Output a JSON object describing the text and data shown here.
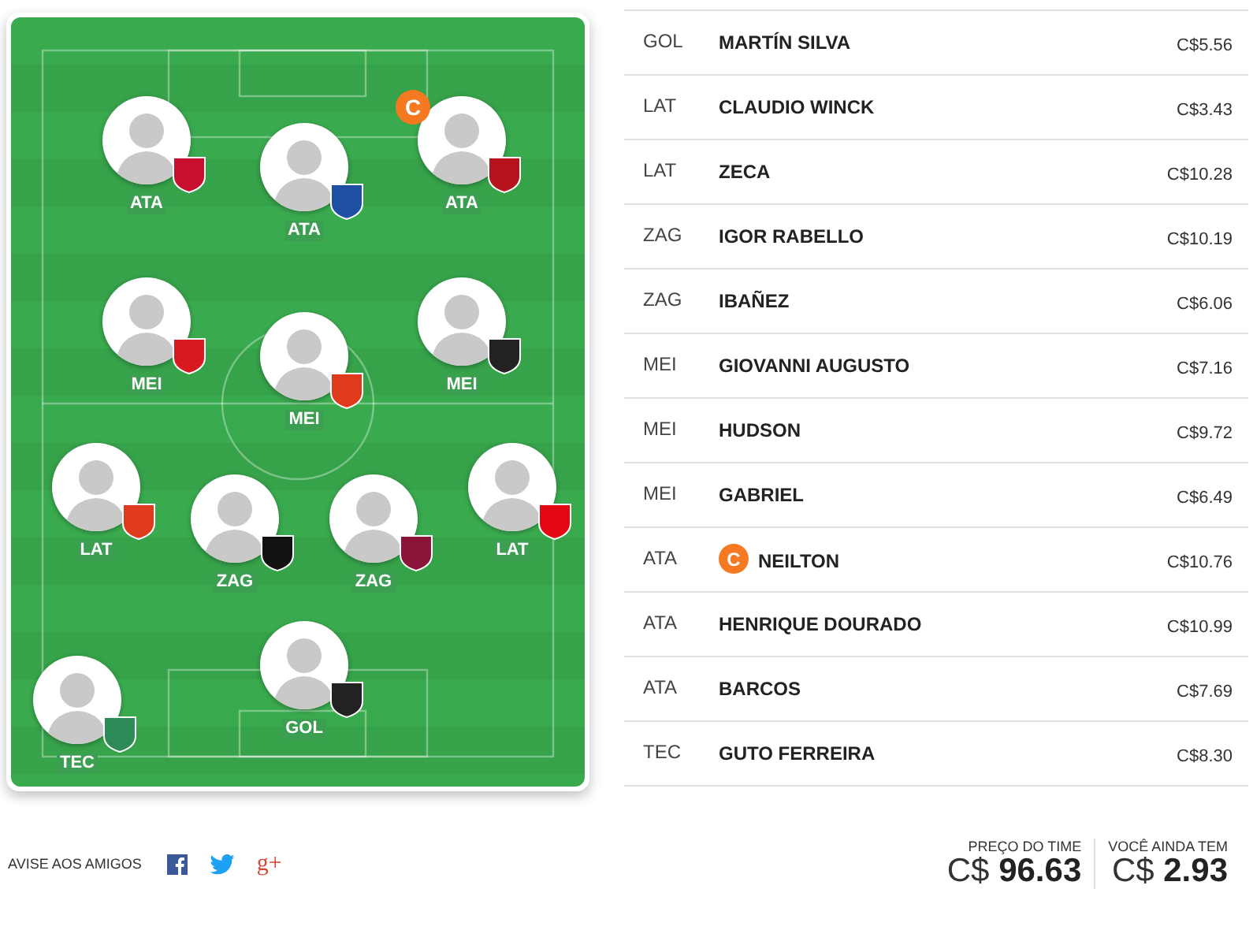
{
  "field": {
    "players": [
      {
        "position": "ATA",
        "captain": false,
        "color": "#c8102e"
      },
      {
        "position": "ATA",
        "captain": false,
        "color": "#1f4fa3"
      },
      {
        "position": "ATA",
        "captain": true,
        "captain_mark": "C",
        "color": "#b5121b"
      },
      {
        "position": "MEI",
        "captain": false,
        "color": "#d71920"
      },
      {
        "position": "MEI",
        "captain": false,
        "color": "#e03a1e"
      },
      {
        "position": "MEI",
        "captain": false,
        "color": "#222222"
      },
      {
        "position": "LAT",
        "captain": false,
        "color": "#e03a1e"
      },
      {
        "position": "ZAG",
        "captain": false,
        "color": "#111111"
      },
      {
        "position": "ZAG",
        "captain": false,
        "color": "#8a1538"
      },
      {
        "position": "LAT",
        "captain": false,
        "color": "#e30613"
      },
      {
        "position": "GOL",
        "captain": false,
        "color": "#222222"
      },
      {
        "position": "TEC",
        "captain": false,
        "color": "#2e8b57"
      }
    ]
  },
  "roster": [
    {
      "position": "GOL",
      "name": "MARTÍN SILVA",
      "price": "C$5.56",
      "captain": false
    },
    {
      "position": "LAT",
      "name": "CLAUDIO WINCK",
      "price": "C$3.43",
      "captain": false
    },
    {
      "position": "LAT",
      "name": "ZECA",
      "price": "C$10.28",
      "captain": false
    },
    {
      "position": "ZAG",
      "name": "IGOR RABELLO",
      "price": "C$10.19",
      "captain": false
    },
    {
      "position": "ZAG",
      "name": "IBAÑEZ",
      "price": "C$6.06",
      "captain": false
    },
    {
      "position": "MEI",
      "name": "GIOVANNI AUGUSTO",
      "price": "C$7.16",
      "captain": false
    },
    {
      "position": "MEI",
      "name": "HUDSON",
      "price": "C$9.72",
      "captain": false
    },
    {
      "position": "MEI",
      "name": "GABRIEL",
      "price": "C$6.49",
      "captain": false
    },
    {
      "position": "ATA",
      "name": "NEILTON",
      "price": "C$10.76",
      "captain": true,
      "captain_mark": "C"
    },
    {
      "position": "ATA",
      "name": "HENRIQUE DOURADO",
      "price": "C$10.99",
      "captain": false
    },
    {
      "position": "ATA",
      "name": "BARCOS",
      "price": "C$7.69",
      "captain": false
    },
    {
      "position": "TEC",
      "name": "GUTO FERREIRA",
      "price": "C$8.30",
      "captain": false
    }
  ],
  "share": {
    "label": "AVISE AOS AMIGOS",
    "g_plus": "g+"
  },
  "totals": [
    {
      "label": "PREÇO DO TIME",
      "value": "C$ **96.63**"
    },
    {
      "label": "VOCÊ AINDA TEM",
      "value": "C$ **2.93**"
    }
  ]
}
